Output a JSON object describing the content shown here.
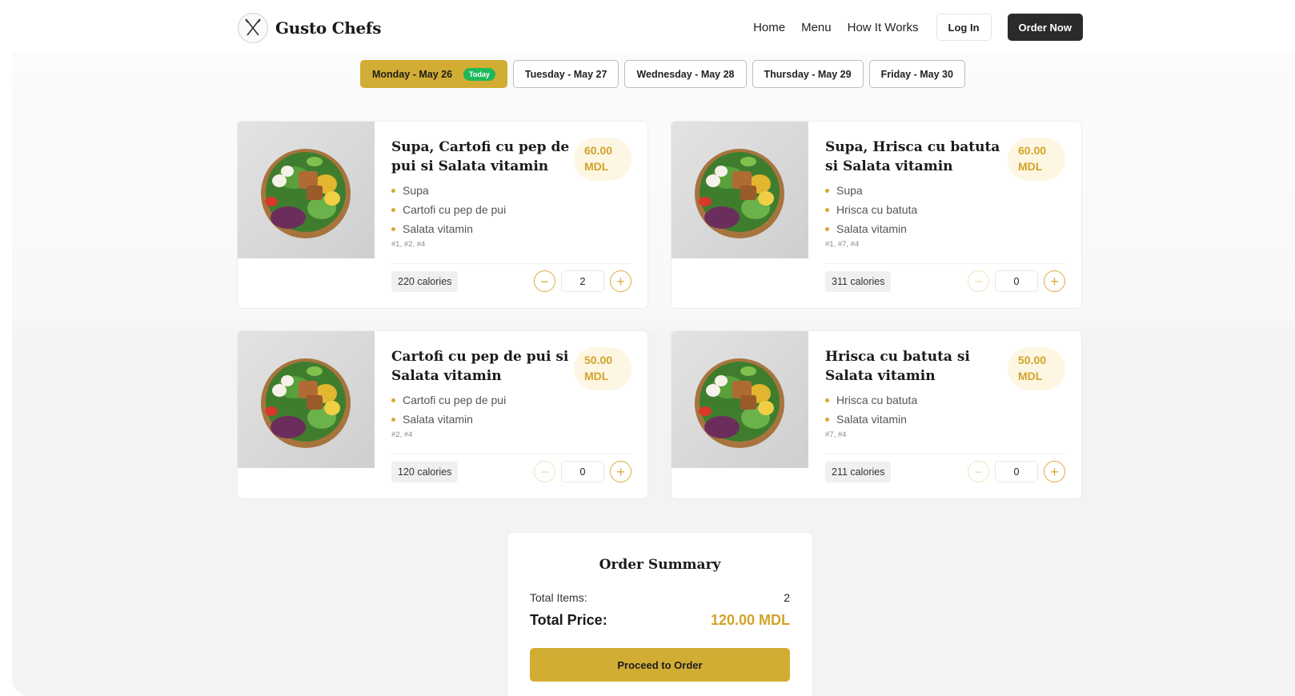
{
  "header": {
    "brand": "Gusto Chefs",
    "logo_text": "GUSTO CHEFS",
    "nav": [
      "Home",
      "Menu",
      "How It Works"
    ],
    "login_label": "Log In",
    "order_now_label": "Order Now"
  },
  "days": [
    {
      "label": "Monday - May 26",
      "badge": "Today",
      "active": true
    },
    {
      "label": "Tuesday - May 27",
      "active": false
    },
    {
      "label": "Wednesday - May 28",
      "active": false
    },
    {
      "label": "Thursday - May 29",
      "active": false
    },
    {
      "label": "Friday - May 30",
      "active": false
    }
  ],
  "menu": [
    {
      "title": "Supa, Cartofi cu pep de pui si Salata vitamin",
      "price": "60.00",
      "currency": "MDL",
      "ingredients": [
        "Supa",
        "Cartofi cu pep de pui",
        "Salata vitamin"
      ],
      "codes": "#1, #2, #4",
      "calories": "220 calories",
      "quantity": "2"
    },
    {
      "title": "Supa, Hrisca cu batuta si Salata vitamin",
      "price": "60.00",
      "currency": "MDL",
      "ingredients": [
        "Supa",
        "Hrisca cu batuta",
        "Salata vitamin"
      ],
      "codes": "#1, #7, #4",
      "calories": "311 calories",
      "quantity": "0"
    },
    {
      "title": "Cartofi cu pep de pui si Salata vitamin",
      "price": "50.00",
      "currency": "MDL",
      "ingredients": [
        "Cartofi cu pep de pui",
        "Salata vitamin"
      ],
      "codes": "#2, #4",
      "calories": "120 calories",
      "quantity": "0"
    },
    {
      "title": "Hrisca cu batuta si Salata vitamin",
      "price": "50.00",
      "currency": "MDL",
      "ingredients": [
        "Hrisca cu batuta",
        "Salata vitamin"
      ],
      "codes": "#7, #4",
      "calories": "211 calories",
      "quantity": "0"
    }
  ],
  "summary": {
    "title": "Order Summary",
    "total_items_label": "Total Items:",
    "total_items": "2",
    "total_price_label": "Total Price:",
    "total_price": "120.00 MDL",
    "proceed_label": "Proceed to Order"
  },
  "colors": {
    "accent": "#d2ad34",
    "price_text": "#d2a329",
    "today_badge": "#1fb85a",
    "dark_button": "#2b2b2b"
  },
  "icons": {
    "logo": "crossed-cutlery-icon",
    "minus": "minus-icon",
    "plus": "plus-icon",
    "bullet": "bullet-dot-icon",
    "dish_photo": "salad-bowl-icon"
  }
}
